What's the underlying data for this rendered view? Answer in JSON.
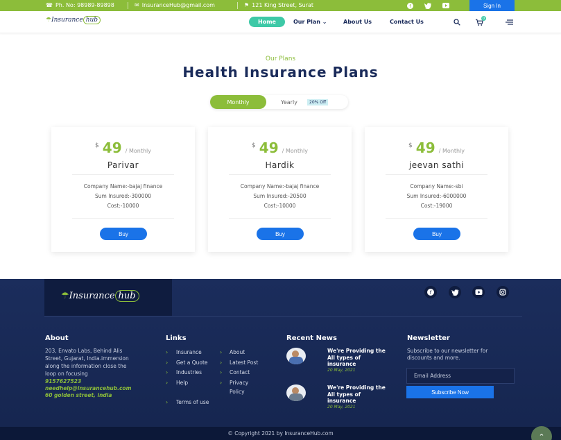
{
  "topbar": {
    "phone": "Ph. No: 98989-89898",
    "email": "InsuranceHub@gmail.com",
    "address": "121 King Street, Surat",
    "social_icons": [
      "facebook-icon",
      "twitter-icon",
      "youtube-icon"
    ],
    "signin_label": "Sign In",
    "bg_color": "#8cbd3a"
  },
  "nav": {
    "logo_text": "Insurance",
    "logo_hub": "hub",
    "items": [
      {
        "label": "Home"
      },
      {
        "label": "Our Plan"
      },
      {
        "label": "About Us"
      },
      {
        "label": "Contact Us"
      }
    ],
    "cart_count": "0"
  },
  "plans": {
    "eyebrow": "Our Plans",
    "heading": "Health Insurance Plans",
    "toggle": {
      "monthly": "Monthly",
      "yearly": "Yearly",
      "discount": "20% Off"
    },
    "cards": [
      {
        "currency": "$",
        "amount": "49",
        "period": "/ Monthly",
        "name": "Parivar",
        "company": "Company Name:-bajaj finance",
        "sum": "Sum Insured:-300000",
        "cost": "Cost:-10000",
        "buy": "Buy"
      },
      {
        "currency": "$",
        "amount": "49",
        "period": "/ Monthly",
        "name": "Hardik",
        "company": "Company Name:-bajaj finance",
        "sum": "Sum Insured:-20500",
        "cost": "Cost:-10000",
        "buy": "Buy"
      },
      {
        "currency": "$",
        "amount": "49",
        "period": "/ Monthly",
        "name": "jeevan sathi",
        "company": "Company Name:-sbi",
        "sum": "Sum Insured:-6000000",
        "cost": "Cost:-19000",
        "buy": "Buy"
      }
    ]
  },
  "footer": {
    "logo_text": "Insurance",
    "logo_hub": "hub",
    "social_icons": [
      "facebook-icon",
      "twitter-icon",
      "youtube-icon",
      "instagram-icon"
    ],
    "about": {
      "title": "About",
      "text1": "203, Envato Labs, Behind Alis",
      "text2": "Street, Gujarat, India.immersion",
      "text3": "along the information close the",
      "text4": "loop on focusing",
      "phone": "9157627523",
      "email": "needhelp@insurancehub.com",
      "address": "60 golden street, india"
    },
    "links": {
      "title": "Links",
      "col1": [
        "Insurance",
        "Get a Quote",
        "Industries",
        "Help",
        "Terms of use"
      ],
      "col2": [
        "About",
        "Latest Post",
        "Contact",
        "Privacy",
        "Policy"
      ]
    },
    "news": {
      "title": "Recent News",
      "items": [
        {
          "line1": "We're Providing the",
          "line2": "All types of",
          "line3": "insurance",
          "date": "20 May, 2021"
        },
        {
          "line1": "We're Providing the",
          "line2": "All types of",
          "line3": "insurance",
          "date": "20 May, 2021"
        }
      ]
    },
    "newsletter": {
      "title": "Newsletter",
      "text1": "Subscribe to our newsletter for",
      "text2": "discounts and more.",
      "placeholder": "Email Address",
      "button": "Subscribe Now"
    },
    "copyright": "© Copyright 2021 by InsuranceHub.com"
  }
}
